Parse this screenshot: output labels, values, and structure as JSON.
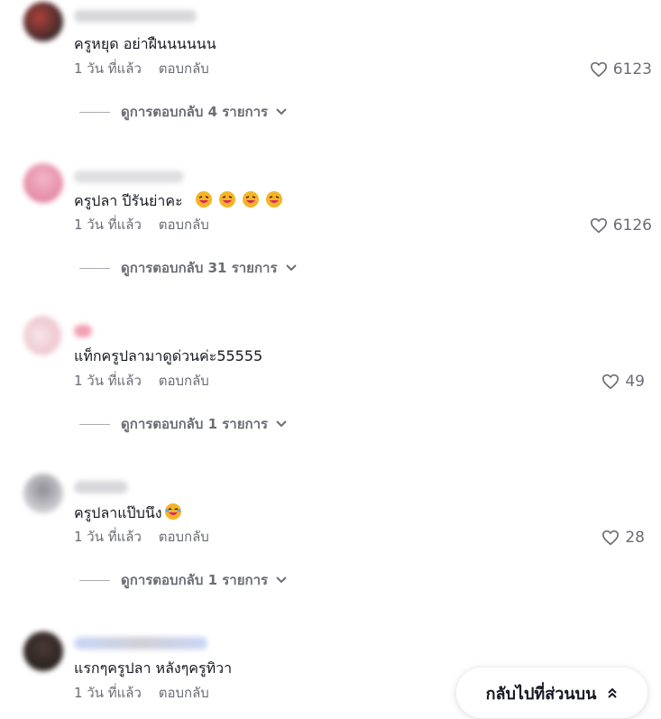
{
  "comments": [
    {
      "text": "ครูหยุด อย่าฝืนนนนนน",
      "time": "1 วัน ที่แล้ว",
      "reply": "ตอบกลับ",
      "likes": "6123",
      "view_replies": "ดูการตอบกลับ 4 รายการ",
      "emoji_count": 0
    },
    {
      "text": "ครูปลา ปีรันย่าคะ",
      "time": "1 วัน ที่แล้ว",
      "reply": "ตอบกลับ",
      "likes": "6126",
      "view_replies": "ดูการตอบกลับ 31 รายการ",
      "emoji_count": 4
    },
    {
      "text": "แท็กครูปลามาดูด่วนค่ะ55555",
      "time": "1 วัน ที่แล้ว",
      "reply": "ตอบกลับ",
      "likes": "49",
      "view_replies": "ดูการตอบกลับ 1 รายการ",
      "emoji_count": 0
    },
    {
      "text": "ครูปลาแป๊บนึง",
      "time": "1 วัน ที่แล้ว",
      "reply": "ตอบกลับ",
      "likes": "28",
      "view_replies": "ดูการตอบกลับ 1 รายการ",
      "emoji_count": 1
    },
    {
      "text": "แรกๆครูปลา หลังๆครูทิวา",
      "time": "1 วัน ที่แล้ว",
      "reply": "ตอบกลับ"
    }
  ],
  "back_to_top": "กลับไปที่ส่วนบน",
  "icons": {
    "like": "heart-outline-icon",
    "expand": "chevron-down-icon",
    "back_to_top": "double-chevron-up-icon",
    "emoji": "laughing-face-emoji"
  },
  "colors": {
    "text_primary": "#161823",
    "text_secondary": "#6b6d76",
    "emoji_face": "#f5b427",
    "emoji_mouth": "#e0245e"
  }
}
